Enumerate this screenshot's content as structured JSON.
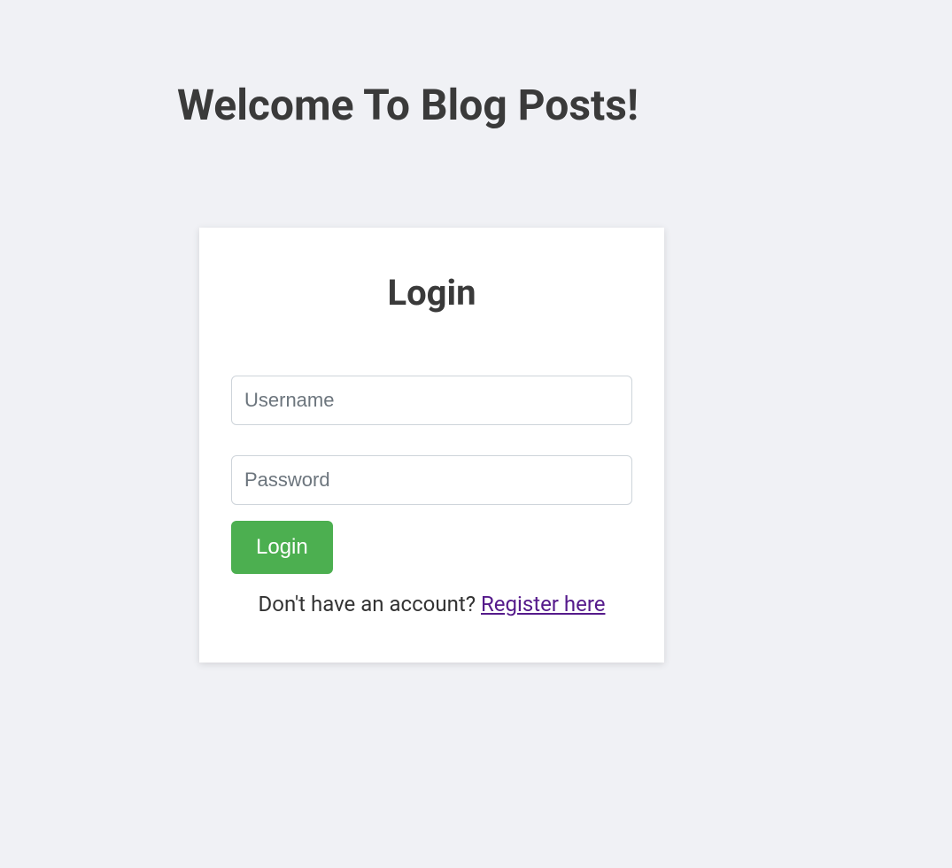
{
  "header": {
    "title": "Welcome To Blog Posts!"
  },
  "login": {
    "title": "Login",
    "username_placeholder": "Username",
    "password_placeholder": "Password",
    "button_label": "Login",
    "register_prompt": "Don't have an account? ",
    "register_link_text": "Register here"
  }
}
